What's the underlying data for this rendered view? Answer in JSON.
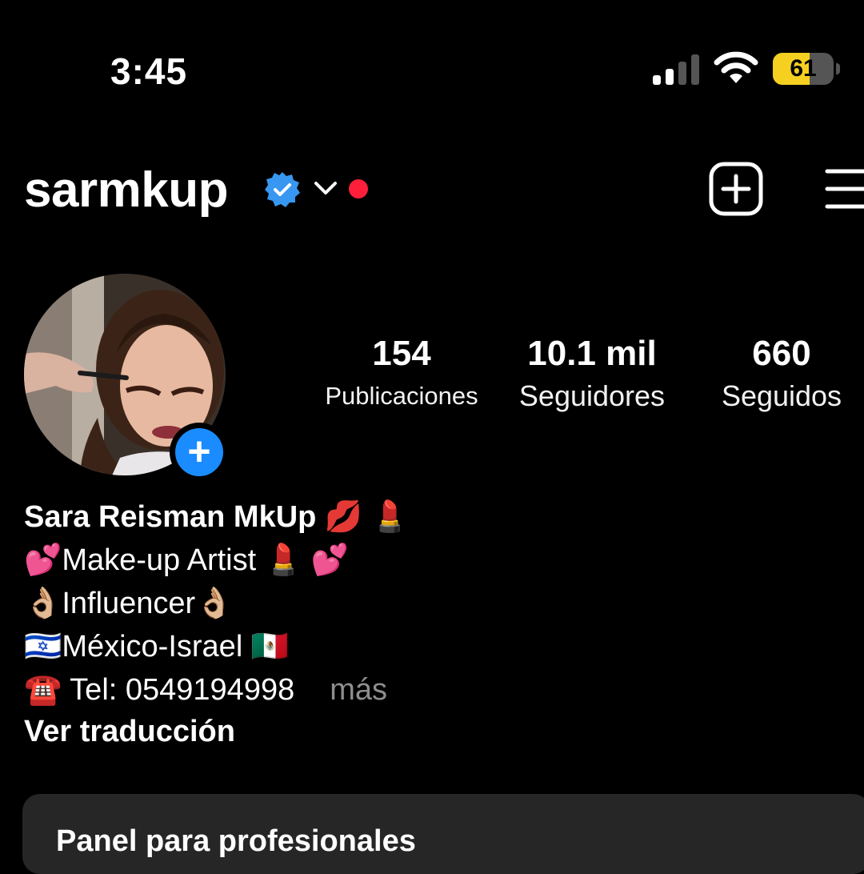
{
  "status_bar": {
    "time": "3:45",
    "battery_level": "61",
    "battery_fraction": 0.61,
    "icons": [
      "cellular-signal-icon",
      "wifi-icon",
      "battery-icon"
    ]
  },
  "header": {
    "username": "sarmkup",
    "verified": true,
    "icons": [
      "verified-badge-icon",
      "chevron-down-icon",
      "notification-dot",
      "create-plus-icon",
      "hamburger-menu-icon"
    ]
  },
  "profile": {
    "avatar_icon": "profile-photo",
    "add_story_icon": "plus-icon",
    "stats": [
      {
        "value": "154",
        "label": "Publicaciones"
      },
      {
        "value": "10.1 mil",
        "label": "Seguidores"
      },
      {
        "value": "660",
        "label": "Seguidos"
      }
    ]
  },
  "bio": {
    "name": "Sara Reisman MkUp 💋 💄",
    "line1": "💕Make-up Artist 💄 💕",
    "line2": "👌🏼Influencer👌🏼",
    "line3": "🇮🇱México-Israel 🇲🇽",
    "line4": "☎️ Tel: 0549194998",
    "more": "más",
    "translate": "Ver traducción"
  },
  "panel": {
    "title": "Panel para profesionales"
  },
  "colors": {
    "background": "#000000",
    "text": "#ffffff",
    "muted": "#8e8e8e",
    "verified_blue": "#3897f0",
    "add_story_blue": "#1a8cff",
    "notification_red": "#ff1f3a",
    "battery_yellow": "#f5d020",
    "panel_bg": "#262626"
  }
}
